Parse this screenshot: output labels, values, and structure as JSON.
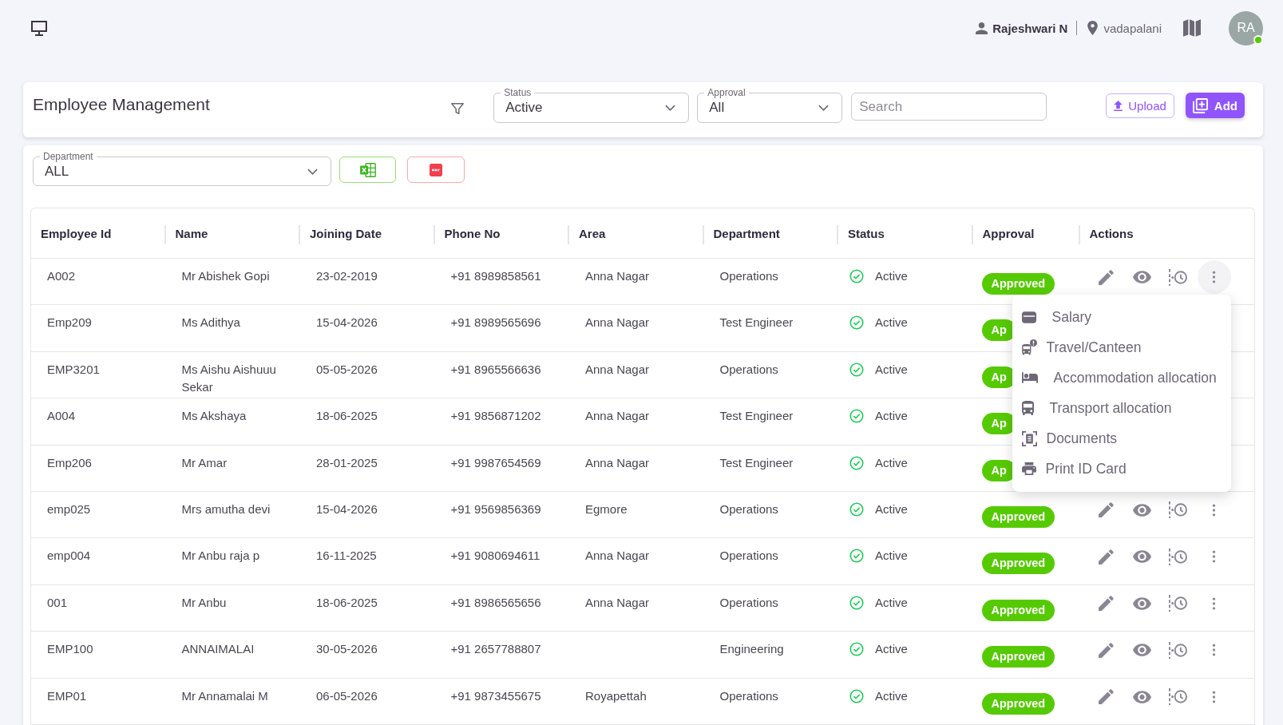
{
  "top_bar": {
    "user_name": "Rajeshwari N",
    "location": "vadapalani",
    "avatar": {
      "initials": "RA",
      "online": true
    }
  },
  "header": {
    "title": "Employee Management",
    "filters": [
      {
        "label": "Status",
        "value": "Active"
      },
      {
        "label": "Approval",
        "value": "All"
      }
    ],
    "search": {
      "placeholder": "Search"
    },
    "buttons": [
      {
        "label": "Upload",
        "kind": "upload"
      },
      {
        "label": "Add",
        "kind": "add"
      }
    ]
  },
  "toolbar": {
    "department": {
      "label": "Department",
      "value": "ALL"
    },
    "exports": [
      {
        "kind": "excel"
      },
      {
        "kind": "pdf"
      }
    ]
  },
  "table": {
    "columns": [
      {
        "label": "Employee Id"
      },
      {
        "label": "Name"
      },
      {
        "label": "Joining Date"
      },
      {
        "label": "Phone No"
      },
      {
        "label": "Area"
      },
      {
        "label": "Department"
      },
      {
        "label": "Status"
      },
      {
        "label": "Approval"
      },
      {
        "label": "Actions"
      }
    ],
    "rows": [
      {
        "employee_id": "A002",
        "name": "Mr Abishek Gopi",
        "joining_date": "23-02-2019",
        "phone_no": "+91 8989858561",
        "area": "Anna Nagar",
        "department": "Operations",
        "status": "Active",
        "approval": "Approved",
        "menu_open": true
      },
      {
        "employee_id": "Emp209",
        "name": "Ms Adithya",
        "joining_date": "15-04-2026",
        "phone_no": "+91 8989565696",
        "area": "Anna Nagar",
        "department": "Test Engineer",
        "status": "Active",
        "approval": "Ap",
        "menu_open": false
      },
      {
        "employee_id": "EMP3201",
        "name": "Ms Aishu Aishuuu Sekar",
        "joining_date": "05-05-2026",
        "phone_no": "+91 8965566636",
        "area": "Anna Nagar",
        "department": "Operations",
        "status": "Active",
        "approval": "Ap",
        "menu_open": false
      },
      {
        "employee_id": "A004",
        "name": "Ms Akshaya",
        "joining_date": "18-06-2025",
        "phone_no": "+91 9856871202",
        "area": "Anna Nagar",
        "department": "Test Engineer",
        "status": "Active",
        "approval": "Ap",
        "menu_open": false
      },
      {
        "employee_id": "Emp206",
        "name": "Mr Amar",
        "joining_date": "28-01-2025",
        "phone_no": "+91 9987654569",
        "area": "Anna Nagar",
        "department": "Test Engineer",
        "status": "Active",
        "approval": "Ap",
        "menu_open": false
      },
      {
        "employee_id": "emp025",
        "name": "Mrs amutha devi",
        "joining_date": "15-04-2026",
        "phone_no": "+91 9569856369",
        "area": "Egmore",
        "department": "Operations",
        "status": "Active",
        "approval": "Approved",
        "menu_open": false
      },
      {
        "employee_id": "emp004",
        "name": "Mr Anbu raja p",
        "joining_date": "16-11-2025",
        "phone_no": "+91 9080694611",
        "area": "Anna Nagar",
        "department": "Operations",
        "status": "Active",
        "approval": "Approved",
        "menu_open": false
      },
      {
        "employee_id": "001",
        "name": "Mr Anbu",
        "joining_date": "18-06-2025",
        "phone_no": "+91 8986565656",
        "area": "Anna Nagar",
        "department": "Operations",
        "status": "Active",
        "approval": "Approved",
        "menu_open": false
      },
      {
        "employee_id": "EMP100",
        "name": "ANNAIMALAI",
        "joining_date": "30-05-2026",
        "phone_no": "+91 2657788807",
        "department": "Engineering",
        "status": "Active",
        "approval": "Approved",
        "menu_open": false
      },
      {
        "employee_id": "EMP01",
        "name": "Mr Annamalai M",
        "joining_date": "06-05-2026",
        "phone_no": "+91 9873455675",
        "area": "Royapettah",
        "department": "Operations",
        "status": "Active",
        "approval": "Approved",
        "menu_open": false
      }
    ],
    "row_menu": {
      "items": [
        {
          "label": "Salary",
          "kind": "card"
        },
        {
          "label": "Travel/Canteen",
          "kind": "bus-alert"
        },
        {
          "label": "Accommodation allocation",
          "kind": "bed"
        },
        {
          "label": "Transport allocation",
          "kind": "bus"
        },
        {
          "label": "Documents",
          "kind": "document"
        },
        {
          "label": "Print ID Card",
          "kind": "printer"
        }
      ]
    }
  }
}
